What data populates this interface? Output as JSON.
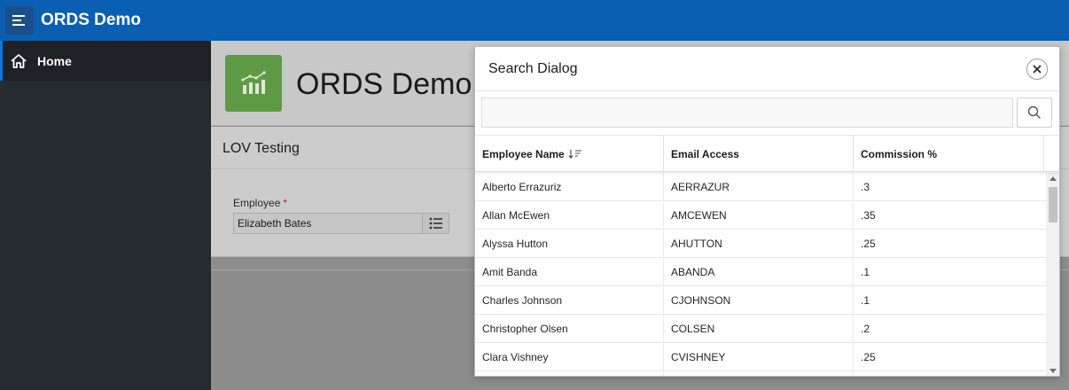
{
  "header": {
    "app_title": "ORDS Demo",
    "menu_icon": "hamburger-menu-icon"
  },
  "sidebar": {
    "items": [
      {
        "label": "Home",
        "icon": "home-icon",
        "active": true
      }
    ]
  },
  "page": {
    "title": "ORDS Demo",
    "icon": "chart-icon",
    "region_title": "LOV Testing",
    "field": {
      "label": "Employee",
      "required_marker": "*",
      "value": "Elizabeth Bates",
      "button_icon": "list-icon"
    }
  },
  "dialog": {
    "title": "Search Dialog",
    "close_icon": "close-icon",
    "search": {
      "value": "",
      "placeholder": "",
      "button_icon": "search-icon"
    },
    "columns": [
      "Employee Name",
      "Email Access",
      "Commission %"
    ],
    "sort_icon": "sort-descending-icon",
    "rows": [
      [
        "Alberto Errazuriz",
        "AERRAZUR",
        ".3"
      ],
      [
        "Allan McEwen",
        "AMCEWEN",
        ".35"
      ],
      [
        "Alyssa Hutton",
        "AHUTTON",
        ".25"
      ],
      [
        "Amit Banda",
        "ABANDA",
        ".1"
      ],
      [
        "Charles Johnson",
        "CJOHNSON",
        ".1"
      ],
      [
        "Christopher Olsen",
        "COLSEN",
        ".2"
      ],
      [
        "Clara Vishney",
        "CVISHNEY",
        ".25"
      ],
      [
        "",
        "",
        ""
      ]
    ]
  },
  "colors": {
    "header_bg": "#0a5fb3",
    "sidebar_bg": "#262a31",
    "hero_icon_bg": "#5e9a44",
    "required": "#c0181f"
  }
}
